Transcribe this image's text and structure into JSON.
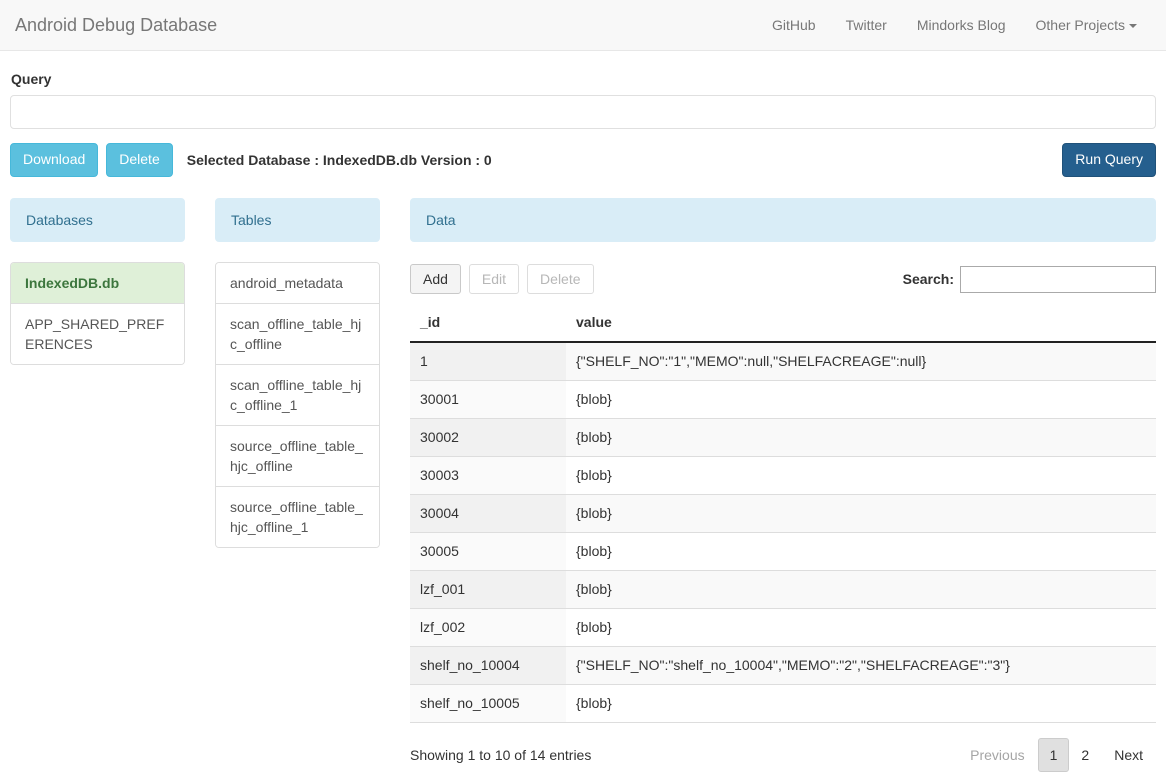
{
  "navbar": {
    "brand": "Android Debug Database",
    "links": [
      {
        "label": "GitHub",
        "name": "nav-link-github"
      },
      {
        "label": "Twitter",
        "name": "nav-link-twitter"
      },
      {
        "label": "Mindorks Blog",
        "name": "nav-link-mindorks-blog"
      },
      {
        "label": "Other Projects",
        "name": "nav-link-other-projects",
        "has_caret": true
      }
    ]
  },
  "query": {
    "label": "Query",
    "value": "",
    "placeholder": ""
  },
  "actions": {
    "download_label": "Download",
    "delete_label": "Delete",
    "selected_database_text": "Selected Database : IndexedDB.db Version : 0",
    "run_query_label": "Run Query"
  },
  "databases_panel": {
    "title": "Databases",
    "items": [
      {
        "label": "IndexedDB.db",
        "selected": true
      },
      {
        "label": "APP_SHARED_PREFERENCES",
        "selected": false
      }
    ]
  },
  "tables_panel": {
    "title": "Tables",
    "items": [
      {
        "label": "android_metadata",
        "selected": false
      },
      {
        "label": "scan_offline_table_hjc_offline",
        "selected": false
      },
      {
        "label": "scan_offline_table_hjc_offline_1",
        "selected": false
      },
      {
        "label": "source_offline_table_hjc_offline",
        "selected": false
      },
      {
        "label": "source_offline_table_hjc_offline_1",
        "selected": false
      }
    ]
  },
  "data_panel": {
    "title": "Data",
    "toolbar": {
      "add_label": "Add",
      "edit_label": "Edit",
      "edit_disabled": true,
      "delete_label": "Delete",
      "delete_disabled": true
    },
    "search": {
      "label": "Search:",
      "value": "",
      "placeholder": ""
    },
    "table": {
      "columns": [
        "_id",
        "value"
      ],
      "rows": [
        [
          "1",
          "{\"SHELF_NO\":\"1\",\"MEMO\":null,\"SHELFACREAGE\":null}"
        ],
        [
          "30001",
          "{blob}"
        ],
        [
          "30002",
          "{blob}"
        ],
        [
          "30003",
          "{blob}"
        ],
        [
          "30004",
          "{blob}"
        ],
        [
          "30005",
          "{blob}"
        ],
        [
          "lzf_001",
          "{blob}"
        ],
        [
          "lzf_002",
          "{blob}"
        ],
        [
          "shelf_no_10004",
          "{\"SHELF_NO\":\"shelf_no_10004\",\"MEMO\":\"2\",\"SHELFACREAGE\":\"3\"}"
        ],
        [
          "shelf_no_10005",
          "{blob}"
        ]
      ]
    },
    "footer": {
      "showing": "Showing 1 to 10 of 14 entries",
      "previous_label": "Previous",
      "pages": [
        "1",
        "2"
      ],
      "current_page": "1",
      "next_label": "Next"
    }
  },
  "colors": {
    "navbar_bg": "#f8f8f8",
    "panel_head_bg": "#d9edf7",
    "panel_head_text": "#31708f",
    "selected_item_bg": "#dff0d8",
    "selected_item_text": "#3c763d",
    "info_button": "#5bc0de",
    "primary_button": "#255f8e"
  }
}
